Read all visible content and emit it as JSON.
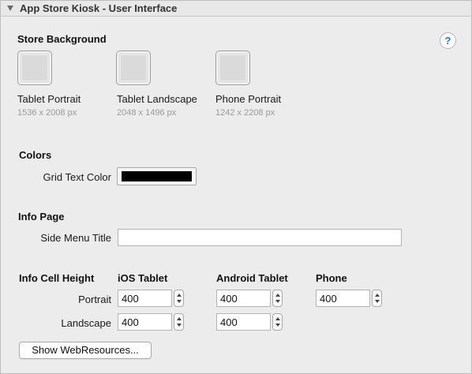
{
  "header": {
    "title": "App Store Kiosk - User Interface"
  },
  "help_icon": "?",
  "store_background": {
    "title": "Store Background",
    "items": [
      {
        "label": "Tablet Portrait",
        "size": "1536 x 2008 px"
      },
      {
        "label": "Tablet Landscape",
        "size": "2048 x 1496 px"
      },
      {
        "label": "Phone Portrait",
        "size": "1242 x 2208 px"
      }
    ]
  },
  "colors": {
    "title": "Colors",
    "grid_text_color_label": "Grid Text Color",
    "grid_text_color_value": "#000000"
  },
  "info_page": {
    "title": "Info Page",
    "side_menu_title_label": "Side Menu Title",
    "side_menu_title_value": ""
  },
  "info_cell_height": {
    "title": "Info Cell Height",
    "columns": [
      "iOS Tablet",
      "Android Tablet",
      "Phone"
    ],
    "rows": [
      {
        "label": "Portrait",
        "ios_tablet": "400",
        "android_tablet": "400",
        "phone": "400"
      },
      {
        "label": "Landscape",
        "ios_tablet": "400",
        "android_tablet": "400"
      }
    ]
  },
  "show_webresources_button": "Show WebResources..."
}
